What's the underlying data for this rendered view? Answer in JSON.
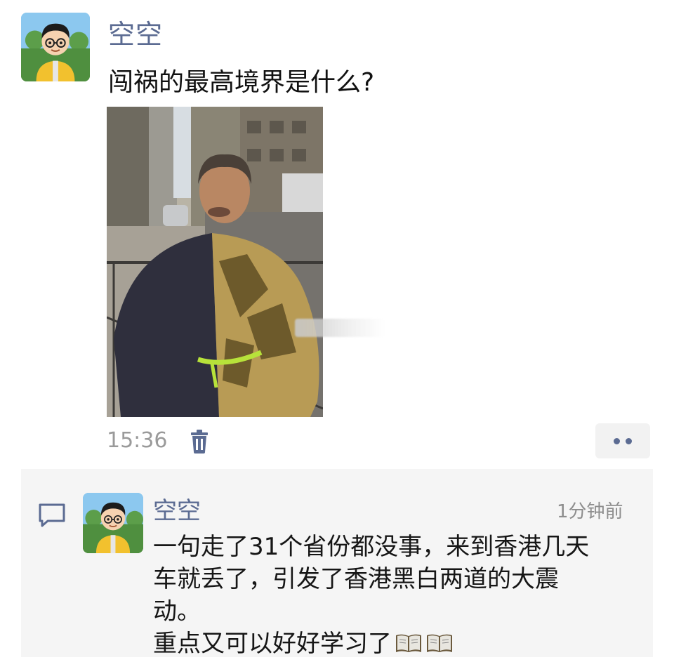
{
  "post": {
    "author": "空空",
    "text": "闯祸的最高境界是什么?",
    "time": "15:36"
  },
  "comment": {
    "author": "空空",
    "time_ago": "1分钟前",
    "text": "一句走了31个省份都没事，来到香港几天\n车就丢了，引发了香港黑白两道的大震\n动。\n重点又可以好好学习了",
    "emoji_name": "open-book-icon",
    "emoji_count": 2
  },
  "icons": {
    "delete": "trash-icon",
    "more": "more-dots-icon",
    "comment": "comment-icon"
  },
  "colors": {
    "name_blue": "#5b6b92",
    "comment_bg": "#f5f5f5",
    "time_gray": "#9a9a9a"
  }
}
